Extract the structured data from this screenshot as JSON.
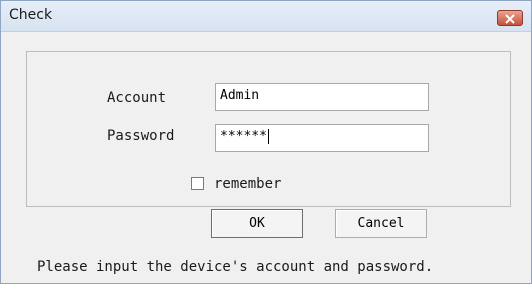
{
  "window": {
    "title": "Check"
  },
  "form": {
    "account_label": "Account",
    "account_value": "Admin",
    "password_label": "Password",
    "password_value": "******",
    "remember_label": "remember",
    "remember_checked": false
  },
  "buttons": {
    "ok_label": "OK",
    "cancel_label": "Cancel"
  },
  "status_text": "Please input the device's account and password.",
  "icons": {
    "close": "close-icon"
  },
  "colors": {
    "close_button": "#c7513a",
    "titlebar": "#dbe6f3"
  }
}
